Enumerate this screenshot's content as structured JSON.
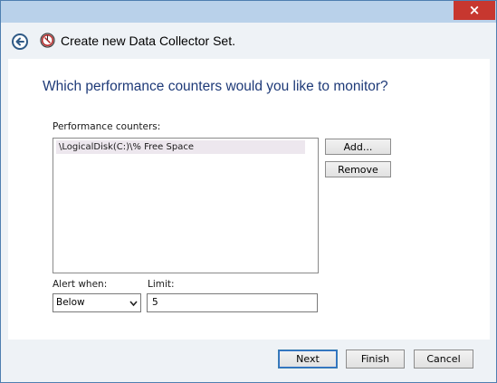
{
  "window": {
    "title": "Create new Data Collector Set.",
    "close_icon": "×"
  },
  "main": {
    "heading": "Which performance counters would you like to monitor?",
    "counters_label": "Performance counters:",
    "counters": [
      "\\LogicalDisk(C:)\\% Free Space"
    ],
    "add_label": "Add...",
    "remove_label": "Remove",
    "alert_when_label": "Alert when:",
    "alert_when_value": "Below",
    "limit_label": "Limit:",
    "limit_value": "5"
  },
  "footer": {
    "next_label": "Next",
    "finish_label": "Finish",
    "cancel_label": "Cancel"
  },
  "colors": {
    "heading": "#1e3a78",
    "close_button": "#c7372f",
    "selection": "#ede7ee"
  },
  "icons": {
    "back": "back-arrow-icon",
    "app": "data-collector-icon",
    "dropdown": "chevron-down-icon"
  }
}
